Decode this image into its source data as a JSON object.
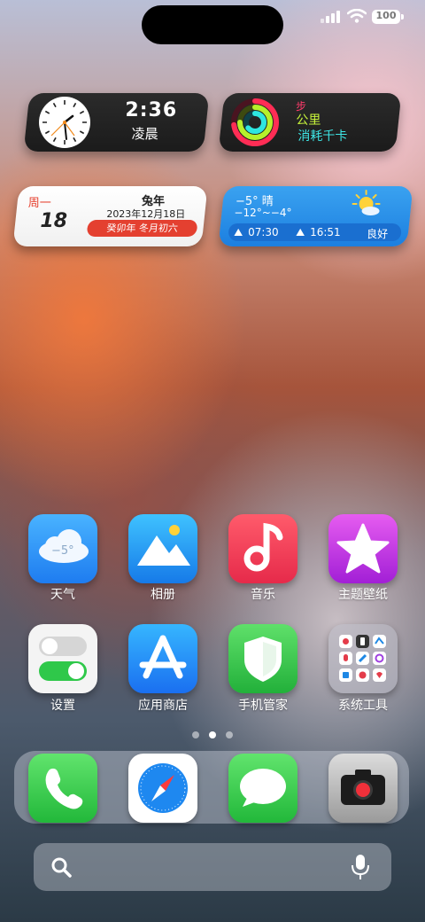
{
  "status_bar": {
    "battery": "100"
  },
  "widgets": {
    "clock": {
      "time": "2:36",
      "period": "凌晨"
    },
    "activity": {
      "steps_label": "步",
      "distance_label": "公里",
      "calories_label": "消耗千卡"
    },
    "calendar": {
      "weekday": "周一",
      "day": "18",
      "zodiac_year": "兔年",
      "date": "2023年12月18日",
      "lunar": "癸卯年 冬月初六"
    },
    "weather": {
      "condition": "−5° 晴",
      "range": "−12°~−4°",
      "sunrise": "07:30",
      "sunset": "16:51",
      "air_quality": "良好"
    }
  },
  "apps": [
    {
      "label": "天气",
      "icon_text": "−5°"
    },
    {
      "label": "相册"
    },
    {
      "label": "音乐"
    },
    {
      "label": "主题壁纸"
    },
    {
      "label": "设置"
    },
    {
      "label": "应用商店"
    },
    {
      "label": "手机管家"
    },
    {
      "label": "系统工具"
    }
  ],
  "page_indicator": {
    "count": 3,
    "active": 2
  },
  "dock": [
    "phone-icon",
    "browser-icon",
    "messages-icon",
    "camera-icon"
  ],
  "colors": {
    "accent_red": "#e44030",
    "weather_blue": "#1c7fe0"
  }
}
